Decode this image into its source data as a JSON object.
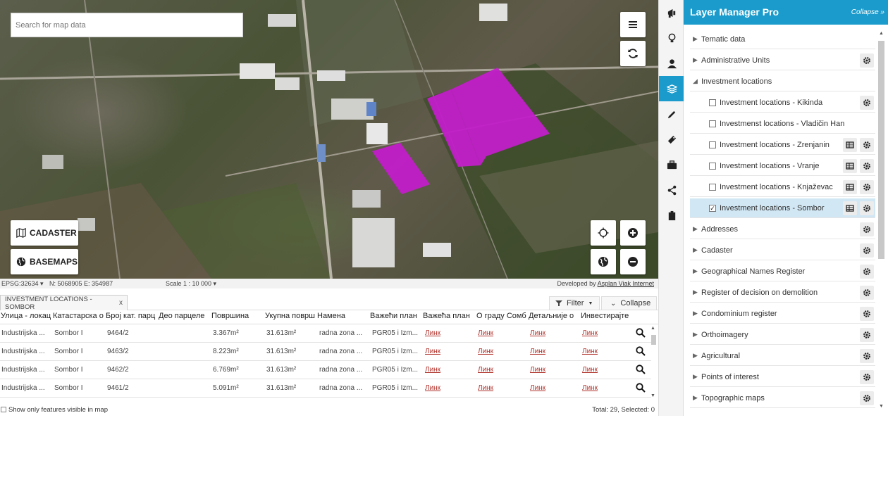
{
  "map": {
    "search_placeholder": "Search for map data",
    "cadaster_label": "CADASTER",
    "basemaps_label": "BASEMAPS"
  },
  "statusbar": {
    "epsg": "EPSG:32634 ▾",
    "coords": "N: 5068905  E: 354987",
    "scale": "Scale 1 : 10 000 ▾",
    "developed_by": "Developed by",
    "developer": "Asplan Viak Internet"
  },
  "table": {
    "tab_label": "INVESTMENT LOCATIONS - SOMBOR",
    "tab_close": "x",
    "filter_label": "Filter",
    "collapse_label": "Collapse",
    "headers": [
      "Улица - локац",
      "Катастарска о",
      "Број кат. парц",
      "Део парцеле",
      "Површина",
      "Укупна површ",
      "Намена",
      "Важећи план",
      "Важећа план",
      "О граду Сомб",
      "Детаљније о",
      "Инвестирајте"
    ],
    "rows": [
      {
        "street": "Industrijska ...",
        "municipality": "Sombor I",
        "parcel": "9464/2",
        "area": "3.367m²",
        "total": "31.613m²",
        "purpose": "radna zona ...",
        "plan": "PGR05 i Izm...",
        "link1": "Линк",
        "link2": "Линк",
        "link3": "Линк",
        "link4": "Линк"
      },
      {
        "street": "Industrijska ...",
        "municipality": "Sombor I",
        "parcel": "9463/2",
        "area": "8.223m²",
        "total": "31.613m²",
        "purpose": "radna zona ...",
        "plan": "PGR05 i Izm...",
        "link1": "Линк",
        "link2": "Линк",
        "link3": "Линк",
        "link4": "Линк"
      },
      {
        "street": "Industrijska ...",
        "municipality": "Sombor I",
        "parcel": "9462/2",
        "area": "6.769m²",
        "total": "31.613m²",
        "purpose": "radna zona ...",
        "plan": "PGR05 i Izm...",
        "link1": "Линк",
        "link2": "Линк",
        "link3": "Линк",
        "link4": "Линк"
      },
      {
        "street": "Industrijska ...",
        "municipality": "Sombor I",
        "parcel": "9461/2",
        "area": "5.091m²",
        "total": "31.613m²",
        "purpose": "radna zona ...",
        "plan": "PGR05 i Izm...",
        "link1": "Линк",
        "link2": "Линк",
        "link3": "Линк",
        "link4": "Линк"
      }
    ],
    "footer_checkbox_label": "Show only features visible in map",
    "footer_total": "Total: 29, Selected: 0"
  },
  "toolbar": {
    "items": [
      "megaphone-icon",
      "lightbulb-icon",
      "user-icon",
      "layers-icon",
      "pencil-icon",
      "measure-icon",
      "briefcase-icon",
      "share-icon",
      "clipboard-icon"
    ],
    "active": "layers-icon"
  },
  "layer_manager": {
    "title": "Layer Manager Pro",
    "collapse_label": "Collapse »",
    "accent_color": "#1a9bcb",
    "groups": {
      "tematic": "Tematic data",
      "admin": "Administrative Units",
      "investment": "Investment locations",
      "addresses": "Addresses",
      "cadaster": "Cadaster",
      "geonames": "Geographical Names Register",
      "demolition": "Register of decision on demolition",
      "condominium": "Condominium register",
      "ortho": "Orthoimagery",
      "agri": "Agricultural",
      "poi": "Points of interest",
      "topo": "Topographic maps"
    },
    "investment_children": {
      "kikinda": "Investment locations - Kikinda",
      "vladicin": "Investmenst locations - Vladičin Han",
      "zrenjanin": "Investment locations - Zrenjanin",
      "vranje": "Investment locations - Vranje",
      "knjazevac": "Investment locations - Knjaževac",
      "sombor": "Investment locations - Sombor"
    },
    "checked_layer": "Investment locations - Sombor"
  }
}
